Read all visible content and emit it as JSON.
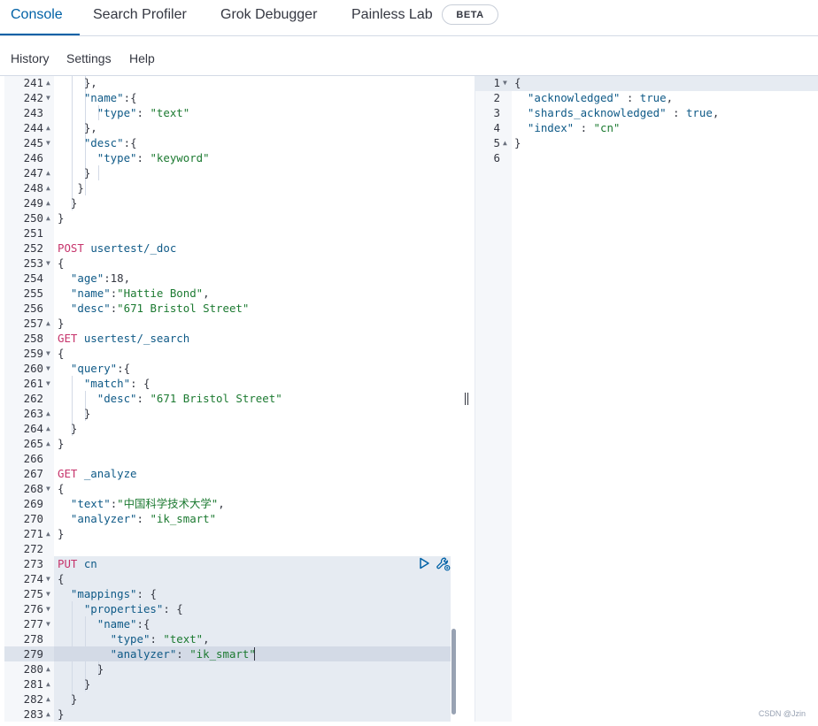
{
  "tabs": [
    {
      "label": "Console"
    },
    {
      "label": "Search Profiler"
    },
    {
      "label": "Grok Debugger"
    },
    {
      "label": "Painless Lab"
    }
  ],
  "beta_badge": "BETA",
  "menu": [
    {
      "label": "History"
    },
    {
      "label": "Settings"
    },
    {
      "label": "Help"
    }
  ],
  "colors": {
    "accent": "#0061a6",
    "method": "#c6336b",
    "string": "#1c7a31",
    "key": "#0f5a87"
  },
  "editor": {
    "lines": [
      {
        "n": "241",
        "f": "up",
        "t": [
          [
            "p",
            "    },"
          ]
        ]
      },
      {
        "n": "242",
        "f": "down",
        "t": [
          [
            "k",
            "    \"name\""
          ],
          [
            "p",
            ":{"
          ]
        ]
      },
      {
        "n": "243",
        "f": "",
        "t": [
          [
            "k",
            "      \"type\""
          ],
          [
            "p",
            ": "
          ],
          [
            "s",
            "\"text\""
          ]
        ]
      },
      {
        "n": "244",
        "f": "up",
        "t": [
          [
            "p",
            "    },"
          ]
        ]
      },
      {
        "n": "245",
        "f": "down",
        "t": [
          [
            "k",
            "    \"desc\""
          ],
          [
            "p",
            ":{"
          ]
        ]
      },
      {
        "n": "246",
        "f": "",
        "t": [
          [
            "k",
            "      \"type\""
          ],
          [
            "p",
            ": "
          ],
          [
            "s",
            "\"keyword\""
          ]
        ]
      },
      {
        "n": "247",
        "f": "up",
        "t": [
          [
            "p",
            "    }"
          ]
        ]
      },
      {
        "n": "248",
        "f": "up",
        "t": [
          [
            "p",
            "   }"
          ]
        ]
      },
      {
        "n": "249",
        "f": "up",
        "t": [
          [
            "p",
            "  }"
          ]
        ]
      },
      {
        "n": "250",
        "f": "up",
        "t": [
          [
            "p",
            "}"
          ]
        ]
      },
      {
        "n": "251",
        "f": "",
        "t": []
      },
      {
        "n": "252",
        "f": "",
        "t": [
          [
            "m",
            "POST "
          ],
          [
            "u",
            "usertest/_doc"
          ]
        ]
      },
      {
        "n": "253",
        "f": "down",
        "t": [
          [
            "p",
            "{"
          ]
        ]
      },
      {
        "n": "254",
        "f": "",
        "t": [
          [
            "k",
            "  \"age\""
          ],
          [
            "p",
            ":18,"
          ]
        ]
      },
      {
        "n": "255",
        "f": "",
        "t": [
          [
            "k",
            "  \"name\""
          ],
          [
            "p",
            ":"
          ],
          [
            "s",
            "\"Hattie Bond\""
          ],
          [
            "p",
            ","
          ]
        ]
      },
      {
        "n": "256",
        "f": "",
        "t": [
          [
            "k",
            "  \"desc\""
          ],
          [
            "p",
            ":"
          ],
          [
            "s",
            "\"671 Bristol Street\""
          ]
        ]
      },
      {
        "n": "257",
        "f": "up",
        "t": [
          [
            "p",
            "}"
          ]
        ]
      },
      {
        "n": "258",
        "f": "",
        "t": [
          [
            "m",
            "GET "
          ],
          [
            "u",
            "usertest/_search"
          ]
        ]
      },
      {
        "n": "259",
        "f": "down",
        "t": [
          [
            "p",
            "{"
          ]
        ]
      },
      {
        "n": "260",
        "f": "down",
        "t": [
          [
            "k",
            "  \"query\""
          ],
          [
            "p",
            ":{"
          ]
        ]
      },
      {
        "n": "261",
        "f": "down",
        "t": [
          [
            "k",
            "    \"match\""
          ],
          [
            "p",
            ": {"
          ]
        ]
      },
      {
        "n": "262",
        "f": "",
        "t": [
          [
            "k",
            "      \"desc\""
          ],
          [
            "p",
            ": "
          ],
          [
            "s",
            "\"671 Bristol Street\""
          ]
        ]
      },
      {
        "n": "263",
        "f": "up",
        "t": [
          [
            "p",
            "    }"
          ]
        ]
      },
      {
        "n": "264",
        "f": "up",
        "t": [
          [
            "p",
            "  }"
          ]
        ]
      },
      {
        "n": "265",
        "f": "up",
        "t": [
          [
            "p",
            "}"
          ]
        ]
      },
      {
        "n": "266",
        "f": "",
        "t": []
      },
      {
        "n": "267",
        "f": "",
        "t": [
          [
            "m",
            "GET "
          ],
          [
            "u",
            "_analyze"
          ]
        ]
      },
      {
        "n": "268",
        "f": "down",
        "t": [
          [
            "p",
            "{"
          ]
        ]
      },
      {
        "n": "269",
        "f": "",
        "t": [
          [
            "k",
            "  \"text\""
          ],
          [
            "p",
            ":"
          ],
          [
            "s",
            "\"中国科学技术大学\""
          ],
          [
            "p",
            ","
          ]
        ]
      },
      {
        "n": "270",
        "f": "",
        "t": [
          [
            "k",
            "  \"analyzer\""
          ],
          [
            "p",
            ": "
          ],
          [
            "s",
            "\"ik_smart\""
          ]
        ]
      },
      {
        "n": "271",
        "f": "up",
        "t": [
          [
            "p",
            "}"
          ]
        ]
      },
      {
        "n": "272",
        "f": "",
        "t": []
      },
      {
        "n": "273",
        "f": "",
        "t": [
          [
            "m",
            "PUT "
          ],
          [
            "u",
            "cn"
          ]
        ]
      },
      {
        "n": "274",
        "f": "down",
        "t": [
          [
            "p",
            "{"
          ]
        ]
      },
      {
        "n": "275",
        "f": "down",
        "t": [
          [
            "k",
            "  \"mappings\""
          ],
          [
            "p",
            ": {"
          ]
        ]
      },
      {
        "n": "276",
        "f": "down",
        "t": [
          [
            "k",
            "    \"properties\""
          ],
          [
            "p",
            ": {"
          ]
        ]
      },
      {
        "n": "277",
        "f": "down",
        "t": [
          [
            "k",
            "      \"name\""
          ],
          [
            "p",
            ":{"
          ]
        ]
      },
      {
        "n": "278",
        "f": "",
        "t": [
          [
            "k",
            "        \"type\""
          ],
          [
            "p",
            ": "
          ],
          [
            "s",
            "\"text\""
          ],
          [
            "p",
            ","
          ]
        ]
      },
      {
        "n": "279",
        "f": "",
        "t": [
          [
            "k",
            "        \"analyzer\""
          ],
          [
            "p",
            ": "
          ],
          [
            "s",
            "\"ik_smart\""
          ]
        ]
      },
      {
        "n": "280",
        "f": "up",
        "t": [
          [
            "p",
            "      }"
          ]
        ]
      },
      {
        "n": "281",
        "f": "up",
        "t": [
          [
            "p",
            "    }"
          ]
        ]
      },
      {
        "n": "282",
        "f": "up",
        "t": [
          [
            "p",
            "  }"
          ]
        ]
      },
      {
        "n": "283",
        "f": "up",
        "t": [
          [
            "p",
            "}"
          ]
        ]
      }
    ]
  },
  "output": {
    "lines": [
      {
        "n": "1",
        "f": "down",
        "t": [
          [
            "p",
            "{"
          ]
        ]
      },
      {
        "n": "2",
        "f": "",
        "t": [
          [
            "k",
            "  \"acknowledged\""
          ],
          [
            "p",
            " : "
          ],
          [
            "w",
            "true"
          ],
          [
            "p",
            ","
          ]
        ]
      },
      {
        "n": "3",
        "f": "",
        "t": [
          [
            "k",
            "  \"shards_acknowledged\""
          ],
          [
            "p",
            " : "
          ],
          [
            "w",
            "true"
          ],
          [
            "p",
            ","
          ]
        ]
      },
      {
        "n": "4",
        "f": "",
        "t": [
          [
            "k",
            "  \"index\""
          ],
          [
            "p",
            " : "
          ],
          [
            "s",
            "\"cn\""
          ]
        ]
      },
      {
        "n": "5",
        "f": "up",
        "t": [
          [
            "p",
            "}"
          ]
        ]
      },
      {
        "n": "6",
        "f": "",
        "t": []
      }
    ]
  },
  "watermark": "CSDN @Jzin"
}
